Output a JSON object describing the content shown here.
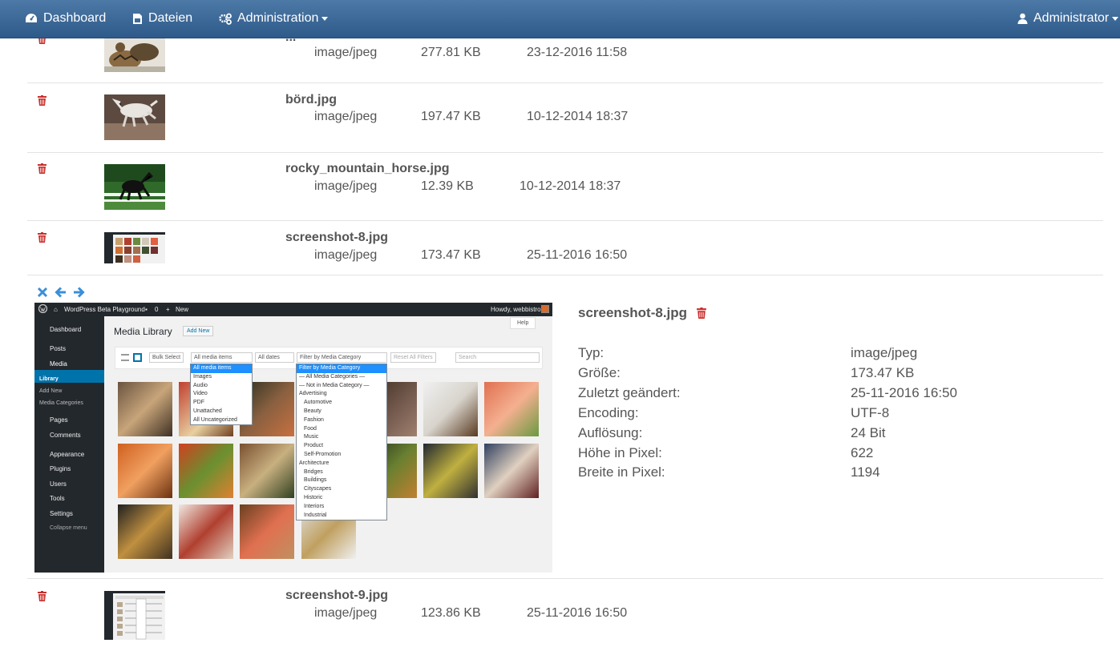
{
  "navbar": {
    "dashboard": "Dashboard",
    "files": "Dateien",
    "admin": "Administration",
    "user": "Administrator"
  },
  "files": [
    {
      "name": "...",
      "type": "image/jpeg",
      "size": "277.81 KB",
      "modified": "23-12-2016 11:58"
    },
    {
      "name": "börd.jpg",
      "type": "image/jpeg",
      "size": "197.47 KB",
      "modified": "10-12-2014 18:37"
    },
    {
      "name": "rocky_mountain_horse.jpg",
      "type": "image/jpeg",
      "size": "12.39 KB",
      "modified": "10-12-2014 18:37"
    },
    {
      "name": "screenshot-8.jpg",
      "type": "image/jpeg",
      "size": "173.47 KB",
      "modified": "25-11-2016 16:50"
    },
    {
      "name": "screenshot-9.jpg",
      "type": "image/jpeg",
      "size": "123.86 KB",
      "modified": "25-11-2016 16:50"
    }
  ],
  "preview": {
    "wp": {
      "site": "WordPress Beta Playground",
      "comments": "0",
      "new": "New",
      "howdy": "Howdy, webbistro",
      "menu": [
        "Dashboard",
        "Posts",
        "Media",
        "Pages",
        "Comments",
        "Appearance",
        "Plugins",
        "Users",
        "Tools",
        "Settings",
        "Collapse menu"
      ],
      "media_sub": [
        "Library",
        "Add New",
        "Media Categories"
      ],
      "title": "Media Library",
      "add_new": "Add New",
      "help": "Help",
      "bulk": "Bulk Select",
      "filter_items": "All media items",
      "filter_dates": "All dates",
      "filter_cat": "Filter by Media Category",
      "reset": "Reset All Filters",
      "search": "Search",
      "items_options": [
        "All media items",
        "Images",
        "Audio",
        "Video",
        "PDF",
        "Unattached",
        "All Uncategorized"
      ],
      "cat_options": [
        "Filter by Media Category",
        "— All Media Categories —",
        "— Not in Media Category —",
        "Advertising",
        "Automotive",
        "Beauty",
        "Fashion",
        "Food",
        "Music",
        "Product",
        "Self-Promotion",
        "Architecture",
        "Bridges",
        "Buildings",
        "Cityscapes",
        "Historic",
        "Interiors",
        "Industrial"
      ]
    }
  },
  "details": {
    "title": "screenshot-8.jpg",
    "labels": [
      "Typ:",
      "Größe:",
      "Zuletzt geändert:",
      "Encoding:",
      "Auflösung:",
      "Höhe in Pixel:",
      "Breite in Pixel:"
    ],
    "values": [
      "image/jpeg",
      "173.47 KB",
      "25-11-2016 16:50",
      "UTF-8",
      "24 Bit",
      "622",
      "1194"
    ]
  },
  "colors": {
    "navbar": "#3f6b9a",
    "trash": "#c9302c",
    "nav_arrows": "#3a8fd9"
  }
}
